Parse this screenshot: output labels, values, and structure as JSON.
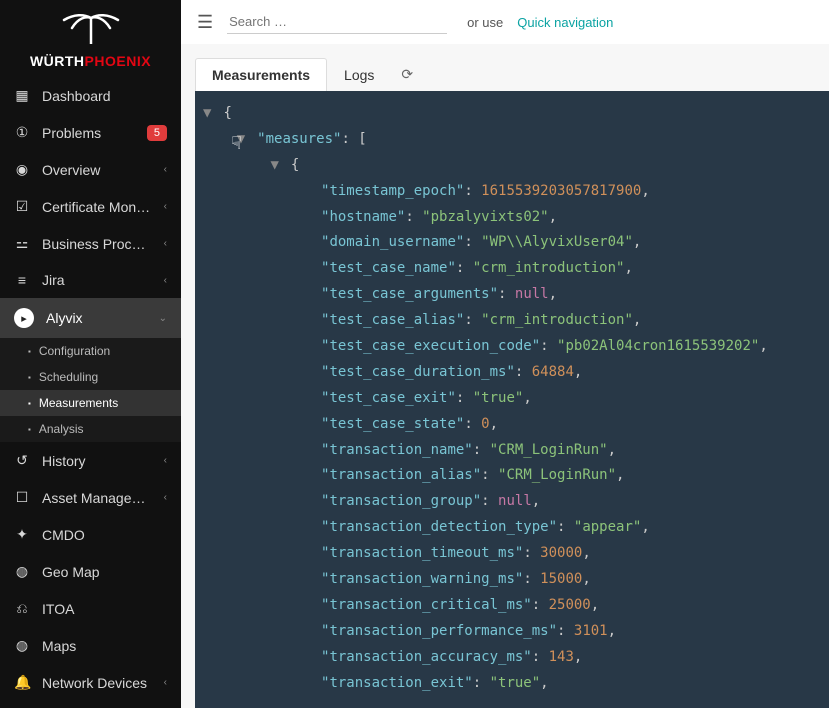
{
  "brand": {
    "first": "WÜRTH",
    "second": "PHOENIX"
  },
  "nav": {
    "dashboard": "Dashboard",
    "problems": "Problems",
    "problems_badge": "5",
    "overview": "Overview",
    "certmon": "Certificate Monito…",
    "bizproc": "Business Process…",
    "jira": "Jira",
    "alyvix": "Alyvix",
    "history": "History",
    "asset": "Asset Management",
    "cmdo": "CMDO",
    "geomap": "Geo Map",
    "itoa": "ITOA",
    "maps": "Maps",
    "netdev": "Network Devices"
  },
  "alyvix_sub": {
    "config": "Configuration",
    "sched": "Scheduling",
    "meas": "Measurements",
    "anal": "Analysis"
  },
  "topbar": {
    "search_placeholder": "Search …",
    "oruse": "or use",
    "quicknav": "Quick navigation"
  },
  "tabs": {
    "measurements": "Measurements",
    "logs": "Logs"
  },
  "json": {
    "measures_key": "\"measures\"",
    "fields": [
      {
        "k": "\"timestamp_epoch\"",
        "v": "1615539203057817900",
        "t": "n"
      },
      {
        "k": "\"hostname\"",
        "v": "\"pbzalyvixts02\"",
        "t": "s"
      },
      {
        "k": "\"domain_username\"",
        "v": "\"WP\\\\AlyvixUser04\"",
        "t": "s"
      },
      {
        "k": "\"test_case_name\"",
        "v": "\"crm_introduction\"",
        "t": "s"
      },
      {
        "k": "\"test_case_arguments\"",
        "v": "null",
        "t": "null"
      },
      {
        "k": "\"test_case_alias\"",
        "v": "\"crm_introduction\"",
        "t": "s"
      },
      {
        "k": "\"test_case_execution_code\"",
        "v": "\"pb02Al04cron1615539202\"",
        "t": "s"
      },
      {
        "k": "\"test_case_duration_ms\"",
        "v": "64884",
        "t": "n"
      },
      {
        "k": "\"test_case_exit\"",
        "v": "\"true\"",
        "t": "s"
      },
      {
        "k": "\"test_case_state\"",
        "v": "0",
        "t": "n"
      },
      {
        "k": "\"transaction_name\"",
        "v": "\"CRM_LoginRun\"",
        "t": "s"
      },
      {
        "k": "\"transaction_alias\"",
        "v": "\"CRM_LoginRun\"",
        "t": "s"
      },
      {
        "k": "\"transaction_group\"",
        "v": "null",
        "t": "null"
      },
      {
        "k": "\"transaction_detection_type\"",
        "v": "\"appear\"",
        "t": "s"
      },
      {
        "k": "\"transaction_timeout_ms\"",
        "v": "30000",
        "t": "n"
      },
      {
        "k": "\"transaction_warning_ms\"",
        "v": "15000",
        "t": "n"
      },
      {
        "k": "\"transaction_critical_ms\"",
        "v": "25000",
        "t": "n"
      },
      {
        "k": "\"transaction_performance_ms\"",
        "v": "3101",
        "t": "n"
      },
      {
        "k": "\"transaction_accuracy_ms\"",
        "v": "143",
        "t": "n"
      },
      {
        "k": "\"transaction_exit\"",
        "v": "\"true\"",
        "t": "s"
      }
    ]
  }
}
